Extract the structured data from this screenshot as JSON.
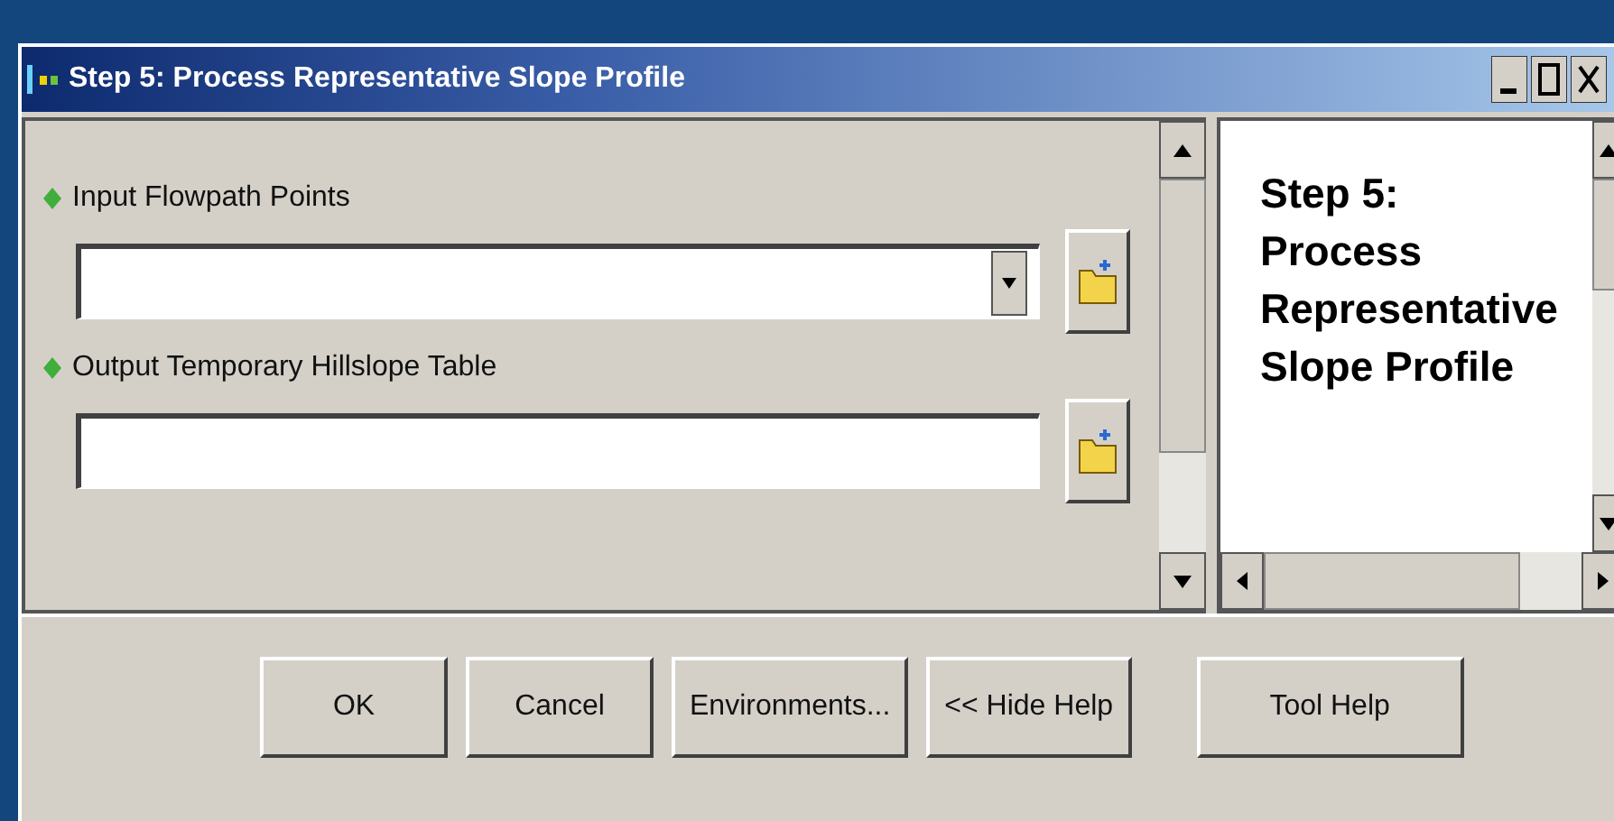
{
  "window": {
    "title": "Step 5: Process Representative Slope Profile"
  },
  "parameters": [
    {
      "label": "Input Flowpath Points",
      "kind": "dropdown"
    },
    {
      "label": "Output Temporary Hillslope Table",
      "kind": "text"
    }
  ],
  "help": {
    "lines": [
      "Step 5:",
      "Process",
      "Representative",
      "Slope Profile"
    ]
  },
  "buttons": [
    "OK",
    "Cancel",
    "Environments...",
    "<< Hide Help",
    "Tool Help"
  ]
}
